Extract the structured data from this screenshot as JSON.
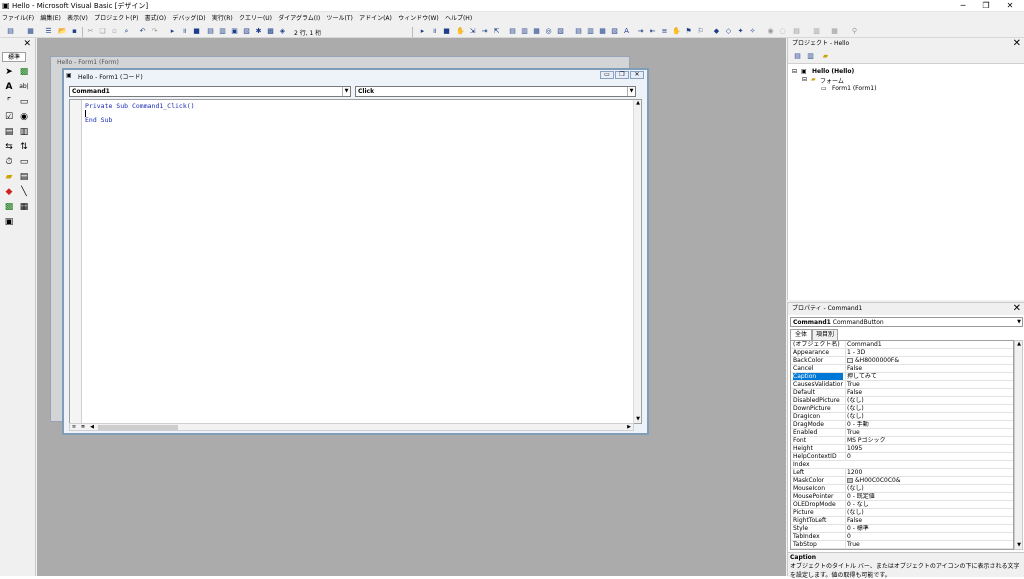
{
  "title": "Hello - Microsoft Visual Basic [デザイン]",
  "menu": [
    "ファイル(F)",
    "編集(E)",
    "表示(V)",
    "プロジェクト(P)",
    "書式(O)",
    "デバッグ(D)",
    "実行(R)",
    "クエリー(U)",
    "ダイアグラム(I)",
    "ツール(T)",
    "アドイン(A)",
    "ウィンドウ(W)",
    "ヘルプ(H)"
  ],
  "toolbar": {
    "position": "2 行, 1 桁"
  },
  "toolbox": {
    "tab": "標準"
  },
  "form_window": {
    "title": "Hello - Form1 (Form)"
  },
  "code_window": {
    "title": "Hello - Form1 (コード)",
    "object_combo": "Command1",
    "proc_combo": "Click",
    "lines": [
      "Private Sub Command1_Click()",
      "",
      "End Sub"
    ]
  },
  "project": {
    "header": "プロジェクト - Hello",
    "root": "Hello (Hello)",
    "folder": "フォーム",
    "form": "Form1 (Form1)"
  },
  "properties": {
    "header": "プロパティ - Command1",
    "object": "Command1",
    "object_type": "CommandButton",
    "tab_all": "全体",
    "tab_cat": "項目別",
    "rows": [
      {
        "n": "(オブジェクト名)",
        "v": "Command1"
      },
      {
        "n": "Appearance",
        "v": "1 - 3D"
      },
      {
        "n": "BackColor",
        "v": "&H8000000F&"
      },
      {
        "n": "Cancel",
        "v": "False"
      },
      {
        "n": "Caption",
        "v": "押してみて"
      },
      {
        "n": "CausesValidation",
        "v": "True"
      },
      {
        "n": "Default",
        "v": "False"
      },
      {
        "n": "DisabledPicture",
        "v": "(なし)"
      },
      {
        "n": "DownPicture",
        "v": "(なし)"
      },
      {
        "n": "DragIcon",
        "v": "(なし)"
      },
      {
        "n": "DragMode",
        "v": "0 - 手動"
      },
      {
        "n": "Enabled",
        "v": "True"
      },
      {
        "n": "Font",
        "v": "MS Pゴシック"
      },
      {
        "n": "Height",
        "v": "1095"
      },
      {
        "n": "HelpContextID",
        "v": "0"
      },
      {
        "n": "Index",
        "v": ""
      },
      {
        "n": "Left",
        "v": "1200"
      },
      {
        "n": "MaskColor",
        "v": "&H00C0C0C0&"
      },
      {
        "n": "MouseIcon",
        "v": "(なし)"
      },
      {
        "n": "MousePointer",
        "v": "0 - 既定値"
      },
      {
        "n": "OLEDropMode",
        "v": "0 - なし"
      },
      {
        "n": "Picture",
        "v": "(なし)"
      },
      {
        "n": "RightToLeft",
        "v": "False"
      },
      {
        "n": "Style",
        "v": "0 - 標準"
      },
      {
        "n": "TabIndex",
        "v": "0"
      },
      {
        "n": "TabStop",
        "v": "True"
      }
    ],
    "desc_title": "Caption",
    "desc_text": "オブジェクトのタイトル バー、またはオブジェクトのアイコンの下に表示される文字を設定します。値の取得も可能です。"
  },
  "colors": {
    "accent": "#0078d7",
    "code": "#1b2ab5",
    "mdi": "#ababab"
  }
}
